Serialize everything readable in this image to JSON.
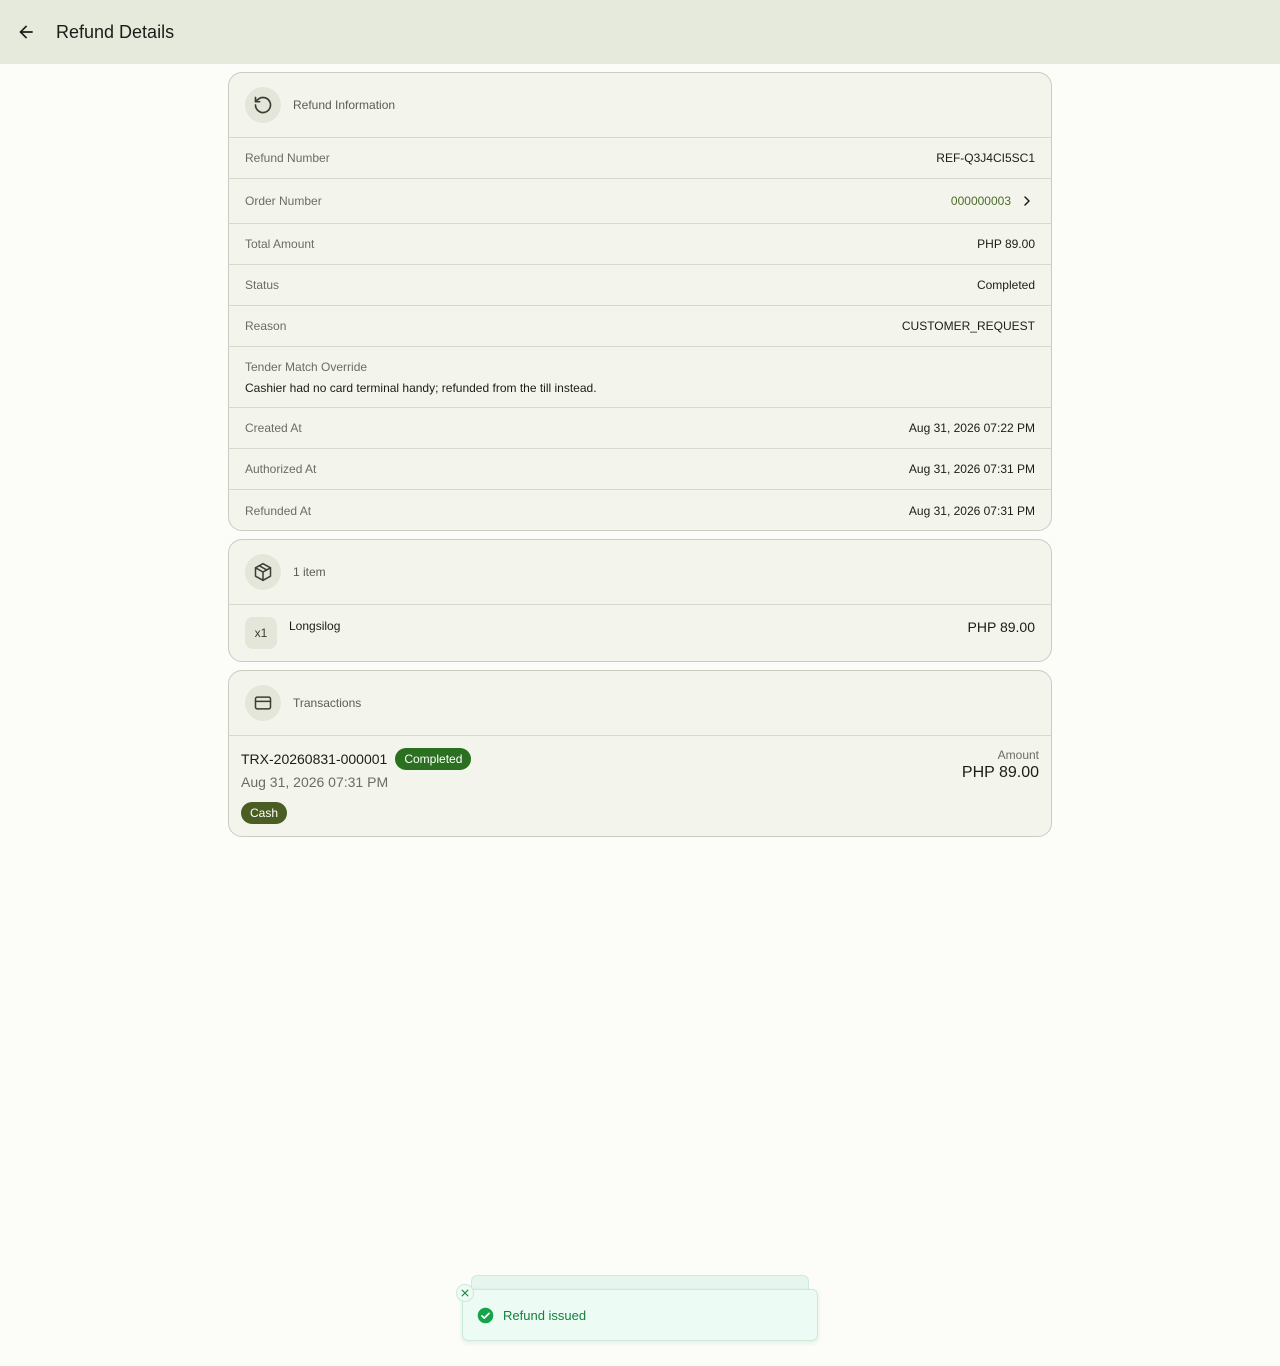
{
  "header": {
    "title": "Refund Details"
  },
  "refund_info": {
    "heading": "Refund Information",
    "refund_number_label": "Refund Number",
    "refund_number": "REF-Q3J4CI5SC1",
    "order_number_label": "Order Number",
    "order_number": "000000003",
    "total_amount_label": "Total Amount",
    "total_amount": "PHP 89.00",
    "status_label": "Status",
    "status": "Completed",
    "reason_label": "Reason",
    "reason": "CUSTOMER_REQUEST",
    "override_label": "Tender Match Override",
    "override_text": "Cashier had no card terminal handy; refunded from the till instead.",
    "created_label": "Created At",
    "created_at": "Aug 31, 2026 07:22 PM",
    "authorized_label": "Authorized At",
    "authorized_at": "Aug 31, 2026 07:31 PM",
    "refunded_label": "Refunded At",
    "refunded_at": "Aug 31, 2026 07:31 PM"
  },
  "items": {
    "heading": "1 item",
    "list": [
      {
        "qty": "x1",
        "name": "Longsilog",
        "price": "PHP 89.00"
      }
    ]
  },
  "transactions": {
    "heading": "Transactions",
    "list": [
      {
        "id": "TRX-20260831-000001",
        "status": "Completed",
        "date": "Aug 31, 2026 07:31 PM",
        "method": "Cash",
        "amount_label": "Amount",
        "amount": "PHP 89.00"
      }
    ]
  },
  "toast": {
    "message": "Refund issued"
  },
  "colors": {
    "app_bar": "#e5eadc",
    "accent": "#4f6a2a",
    "badge_completed": "#2b6f20",
    "chip_cash": "#4a5d23",
    "toast_text": "#15803d"
  }
}
